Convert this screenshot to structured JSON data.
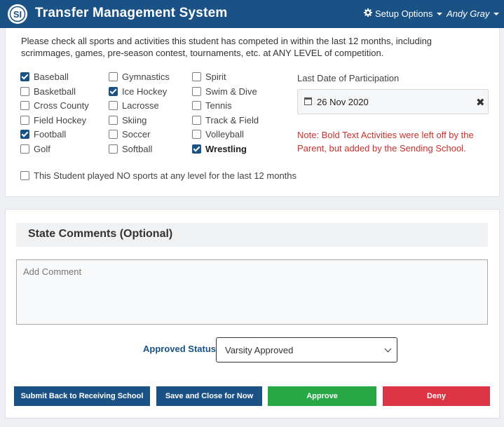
{
  "header": {
    "title": "Transfer Management System",
    "setup_label": "Setup Options",
    "user_label": "Andy Gray"
  },
  "sports_section": {
    "instructions": "Please check all sports and activities this student has competed in within the last 12 months, including scrimmages, games, pre-season contest, tournaments, etc. at ANY LEVEL of  competition.",
    "columns": [
      [
        {
          "label": "Baseball",
          "checked": true,
          "bold": false
        },
        {
          "label": "Basketball",
          "checked": false,
          "bold": false
        },
        {
          "label": "Cross County",
          "checked": false,
          "bold": false
        },
        {
          "label": "Field Hockey",
          "checked": false,
          "bold": false
        },
        {
          "label": "Football",
          "checked": true,
          "bold": false
        },
        {
          "label": "Golf",
          "checked": false,
          "bold": false
        }
      ],
      [
        {
          "label": "Gymnastics",
          "checked": false,
          "bold": false
        },
        {
          "label": "Ice Hockey",
          "checked": true,
          "bold": false
        },
        {
          "label": "Lacrosse",
          "checked": false,
          "bold": false
        },
        {
          "label": "Skiing",
          "checked": false,
          "bold": false
        },
        {
          "label": "Soccer",
          "checked": false,
          "bold": false
        },
        {
          "label": "Softball",
          "checked": false,
          "bold": false
        }
      ],
      [
        {
          "label": "Spirit",
          "checked": false,
          "bold": false
        },
        {
          "label": "Swim & Dive",
          "checked": false,
          "bold": false
        },
        {
          "label": "Tennis",
          "checked": false,
          "bold": false
        },
        {
          "label": "Track & Field",
          "checked": false,
          "bold": false
        },
        {
          "label": "Volleyball",
          "checked": false,
          "bold": false
        },
        {
          "label": "Wrestling",
          "checked": true,
          "bold": true
        }
      ]
    ],
    "last_date_label": "Last Date of Participation",
    "last_date_value": "26 Nov 2020",
    "note": "Note: Bold Text Activities were left off by the Parent, but added by the Sending School.",
    "no_sports_label": "This Student played NO sports at any level for the last 12 months",
    "no_sports_checked": false
  },
  "comments_section": {
    "title": "State Comments (Optional)",
    "comment_placeholder": "Add Comment",
    "comment_value": "",
    "status_label": "Approved Status",
    "status_value": "Varsity Approved"
  },
  "actions": {
    "submit_label": "Submit Back to Receiving School",
    "save_label": "Save and Close for Now",
    "approve_label": "Approve",
    "deny_label": "Deny"
  },
  "colors": {
    "primary": "#1b5286",
    "approve": "#28a745",
    "deny": "#dc3545",
    "note": "#c9302c"
  }
}
